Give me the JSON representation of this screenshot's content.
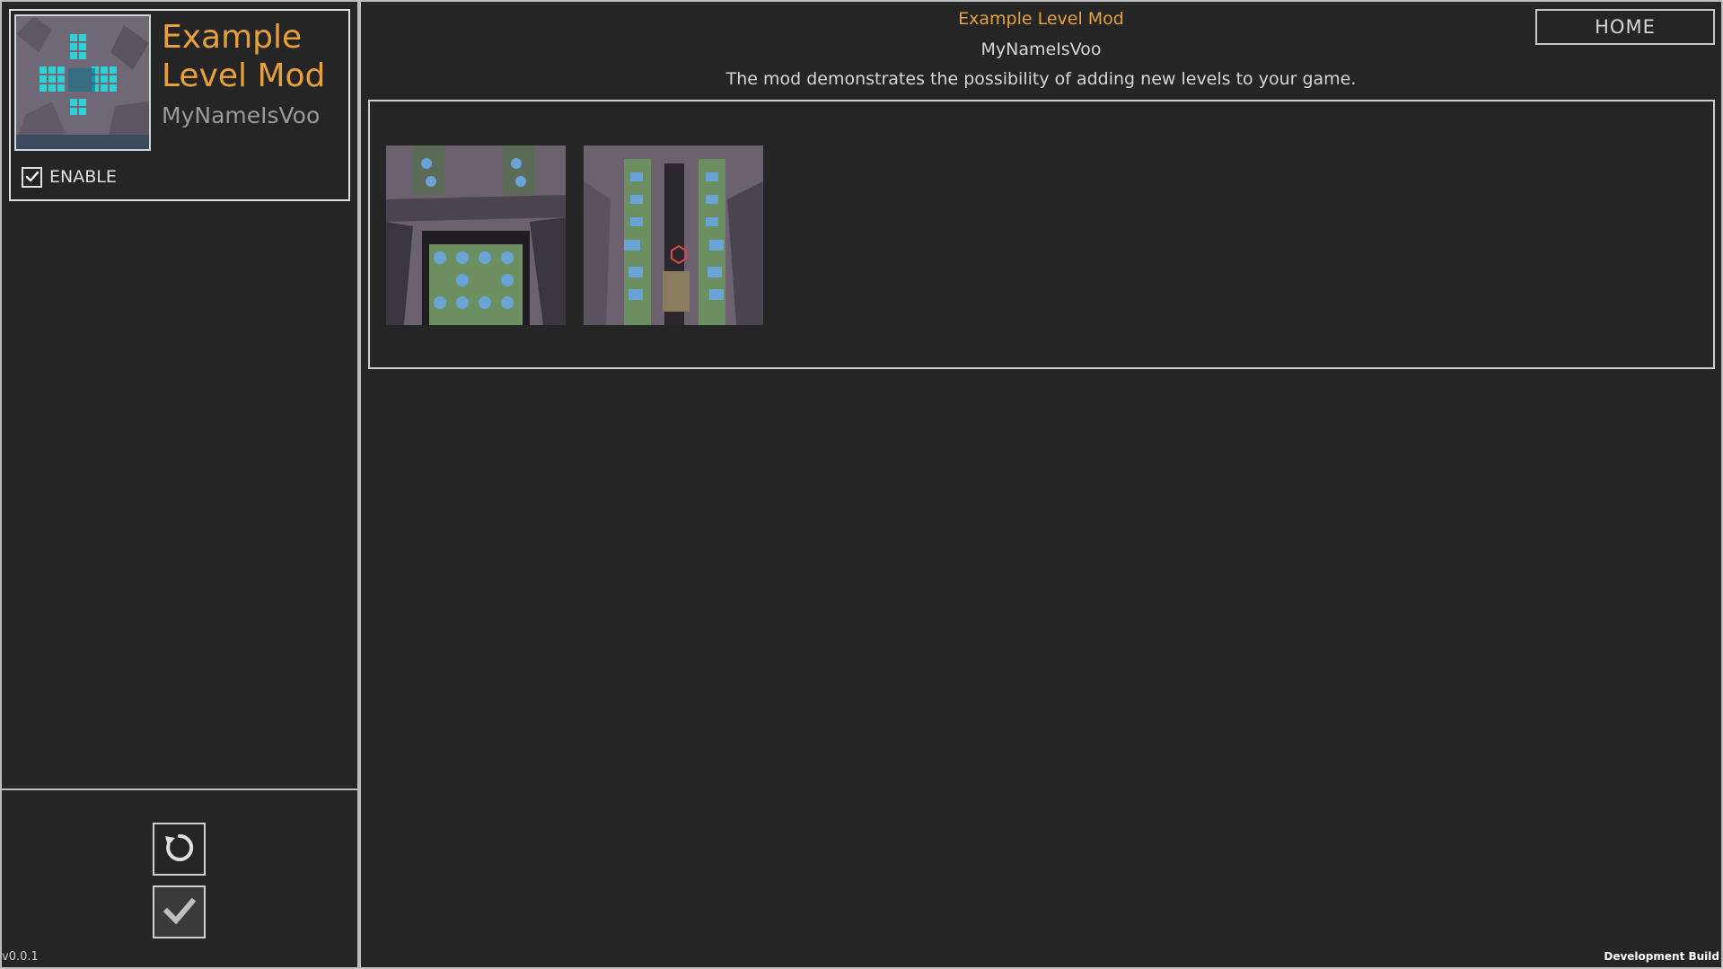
{
  "mod_list": {
    "items": [
      {
        "title": "Example Level Mod",
        "author": "MyNameIsVoo",
        "enable_label": "ENABLE",
        "enabled": true
      }
    ]
  },
  "detail": {
    "title": "Example Level Mod",
    "author": "MyNameIsVoo",
    "description": "The mod demonstrates the possibility of adding new levels to your game.",
    "home_label": "HOME",
    "screenshots": [
      "screenshot-1",
      "screenshot-2"
    ]
  },
  "footer": {
    "version": "v0.0.1",
    "build": "Development Build"
  },
  "icons": {
    "reset": "reset-icon",
    "apply": "checkmark-icon",
    "enable": "checkbox-checked-icon"
  },
  "colors": {
    "background": "#252525",
    "accent": "#e8a13a",
    "border": "#bdbdbd",
    "text": "#d6d6d6"
  }
}
